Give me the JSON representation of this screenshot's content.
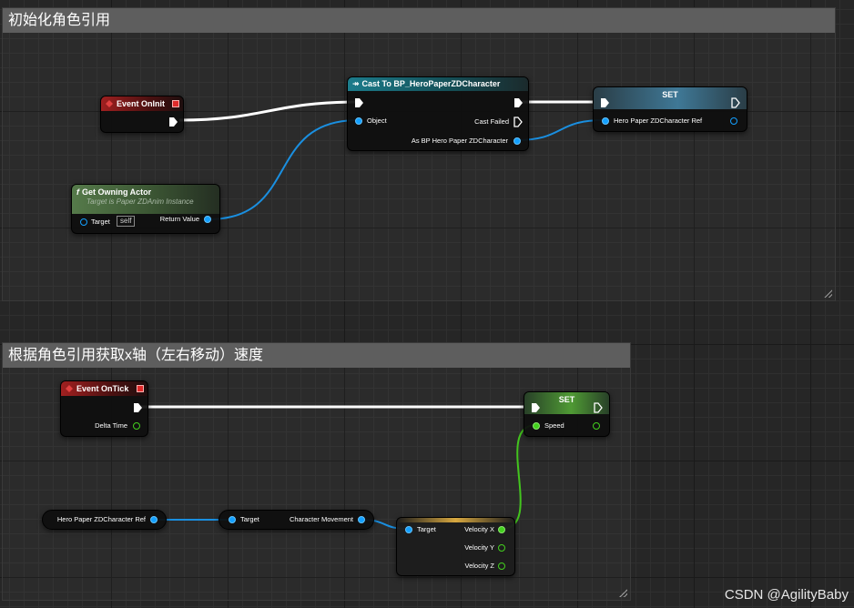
{
  "comments": [
    {
      "title": "初始化角色引用"
    },
    {
      "title": "根据角色引用获取x轴（左右移动）速度"
    }
  ],
  "nodes": {
    "event_oninit": {
      "title": "Event OnInit"
    },
    "cast": {
      "title": "Cast To BP_HeroPaperZDCharacter",
      "object_pin": "Object",
      "cast_failed_pin": "Cast Failed",
      "as_pin": "As BP Hero Paper ZDCharacter"
    },
    "set_hero": {
      "title": "SET",
      "pin": "Hero Paper ZDCharacter Ref"
    },
    "get_owning_actor": {
      "title": "Get Owning Actor",
      "subtitle": "Target is Paper ZDAnim Instance",
      "target_pin": "Target",
      "target_value": "self",
      "return_pin": "Return Value"
    },
    "event_ontick": {
      "title": "Event OnTick",
      "delta_pin": "Delta Time"
    },
    "set_speed": {
      "title": "SET",
      "pin": "Speed"
    },
    "hero_ref_getter": {
      "label": "Hero Paper ZDCharacter Ref"
    },
    "char_movement": {
      "target_pin": "Target",
      "output_pin": "Character Movement"
    },
    "break_velocity": {
      "target_pin": "Target",
      "velocity_x": "Velocity X",
      "velocity_y": "Velocity Y",
      "velocity_z": "Velocity Z"
    }
  },
  "watermark": "CSDN @AgilityBaby",
  "colors": {
    "object_pin": "#14a0ff",
    "float_pin": "#43d01e",
    "exec_wire": "#ffffff",
    "event_header": "#a02020",
    "cast_header": "#1c7c8c",
    "function_header": "#557a4a"
  },
  "icons": [
    "event-icon",
    "delete-icon",
    "cast-icon",
    "function-icon",
    "exec-pin-icon",
    "data-pin-icon",
    "resize-grip-icon"
  ]
}
